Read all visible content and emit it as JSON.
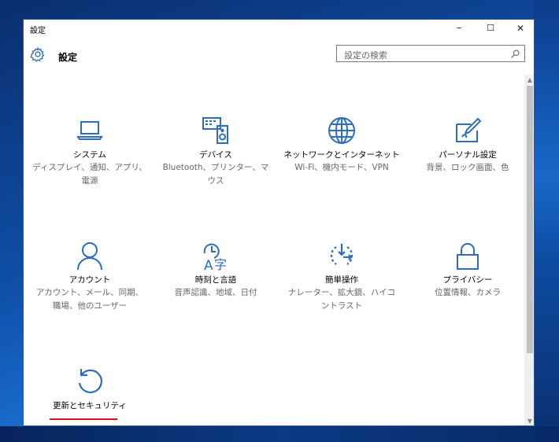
{
  "window": {
    "title": "設定",
    "minimize": "–",
    "maximize": "☐",
    "close": "✕"
  },
  "header": {
    "title": "設定",
    "search_placeholder": "設定の検索"
  },
  "tiles": [
    {
      "name": "システム",
      "desc": [
        "ディスプレイ、通知、アプリ、",
        "電源"
      ],
      "icon": "laptop-icon"
    },
    {
      "name": "デバイス",
      "desc": [
        "Bluetooth、プリンター、マ",
        "ウス"
      ],
      "icon": "devices-icon"
    },
    {
      "name": "ネットワークとインターネット",
      "desc": [
        "Wi-Fi、機内モード、VPN"
      ],
      "icon": "globe-icon"
    },
    {
      "name": "パーソナル設定",
      "desc": [
        "背景、ロック画面、色"
      ],
      "icon": "personalization-icon"
    },
    {
      "name": "アカウント",
      "desc": [
        "アカウント、メール、同期、",
        "職場、他のユーザー"
      ],
      "icon": "person-icon"
    },
    {
      "name": "時刻と言語",
      "desc": [
        "音声認識、地域、日付"
      ],
      "icon": "time-language-icon"
    },
    {
      "name": "簡単操作",
      "desc": [
        "ナレーター、拡大鏡、ハイコ",
        "ントラスト"
      ],
      "icon": "ease-of-access-icon"
    },
    {
      "name": "プライバシー",
      "desc": [
        "位置情報、カメラ"
      ],
      "icon": "lock-icon"
    },
    {
      "name": "更新とセキュリティ",
      "desc": [
        ""
      ],
      "icon": "refresh-icon"
    }
  ],
  "colors": {
    "accent": "#2b6cc4",
    "highlight_underline": "#e01010"
  }
}
